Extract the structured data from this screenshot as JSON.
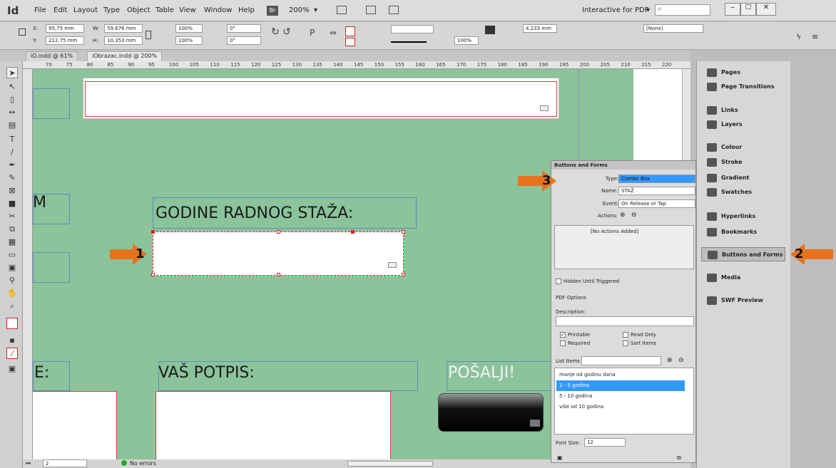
{
  "app": {
    "logo": "Id",
    "menus": [
      "File",
      "Edit",
      "Layout",
      "Type",
      "Object",
      "Table",
      "View",
      "Window",
      "Help"
    ],
    "bridge": "Br",
    "zoom": "200%",
    "workspace": "Interactive for PDF"
  },
  "controls": {
    "x_label": "X:",
    "x": "95,75 mm",
    "y_label": "Y:",
    "y": "212,75 mm",
    "w_label": "W:",
    "w": "59,676 mm",
    "h_label": "H:",
    "h": "10,353 mm",
    "scale_x": "100%",
    "scale_y": "100%",
    "angle": "0°",
    "shear": "0°",
    "stroke": "4,233 mm",
    "stroke_percent": "100%",
    "style": "[None]"
  },
  "tabs": [
    "iO.indd @ 61%",
    "iObrazac.indd @ 200%"
  ],
  "ruler": [
    "70",
    "75",
    "80",
    "85",
    "90",
    "95",
    "100",
    "105",
    "110",
    "115",
    "120",
    "125",
    "130",
    "135",
    "140",
    "145",
    "150",
    "155",
    "160",
    "165",
    "170",
    "175",
    "180",
    "185",
    "190",
    "195",
    "200",
    "205",
    "210",
    "215",
    "220"
  ],
  "canvas": {
    "label_staz": "GODINE RADNOG STAŽA:",
    "label_potpis": "VAŠ POTPIS:",
    "label_posalji": "POŠALJI!",
    "partial_m": "M",
    "partial_e": "E:"
  },
  "status": {
    "page": "2",
    "errors": "No errors"
  },
  "right_panel": [
    "Pages",
    "Page Transitions",
    "Links",
    "Layers",
    "Colour",
    "Stroke",
    "Gradient",
    "Swatches",
    "Hyperlinks",
    "Bookmarks",
    "Buttons and Forms",
    "Media",
    "SWF Preview"
  ],
  "dialog": {
    "title": "Buttons and Forms",
    "type_label": "Type:",
    "type_value": "Combo Box",
    "name_label": "Name:",
    "name_value": "STAŽ",
    "event_label": "Event:",
    "event_value": "On Release or Tap",
    "actions_label": "Actions:",
    "no_actions": "[No Actions Added]",
    "hidden": "Hidden Until Triggered",
    "pdf_options": "PDF Options",
    "description": "Description:",
    "printable": "Printable",
    "read_only": "Read Only",
    "required": "Required",
    "sort_items": "Sort Items",
    "list_items_label": "List Items",
    "list_items": [
      "manje od godinu dana",
      "1 - 5 godina",
      "5 - 10 godina",
      "više od 10 godina"
    ],
    "selected_item_index": 1,
    "font_size_label": "Font Size:",
    "font_size": "12"
  },
  "annotations": [
    "1",
    "2",
    "3"
  ],
  "colors": {
    "accent_arrow": "#e8731c",
    "canvas": "#8bc39b",
    "selection": "#3399ff"
  }
}
